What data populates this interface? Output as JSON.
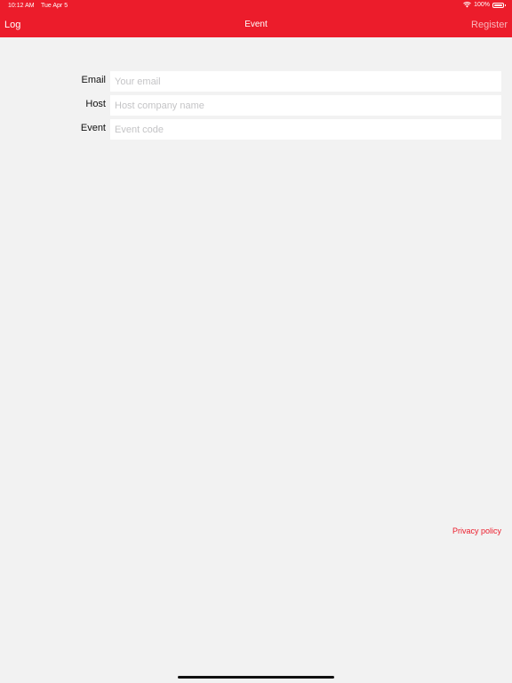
{
  "status_bar": {
    "time": "10:12 AM",
    "date": "Tue Apr 5",
    "battery": "100%"
  },
  "nav": {
    "left_label": "Log",
    "title": "Event",
    "right_label": "Register"
  },
  "form": {
    "email": {
      "label": "Email",
      "placeholder": "Your email",
      "value": ""
    },
    "host": {
      "label": "Host",
      "placeholder": "Host company name",
      "value": ""
    },
    "event": {
      "label": "Event",
      "placeholder": "Event code",
      "value": ""
    }
  },
  "footer": {
    "privacy_label": "Privacy policy"
  },
  "colors": {
    "accent": "#ec1c2b",
    "background": "#f2f2f2"
  },
  "icons": [
    "wifi-icon",
    "battery-icon"
  ]
}
